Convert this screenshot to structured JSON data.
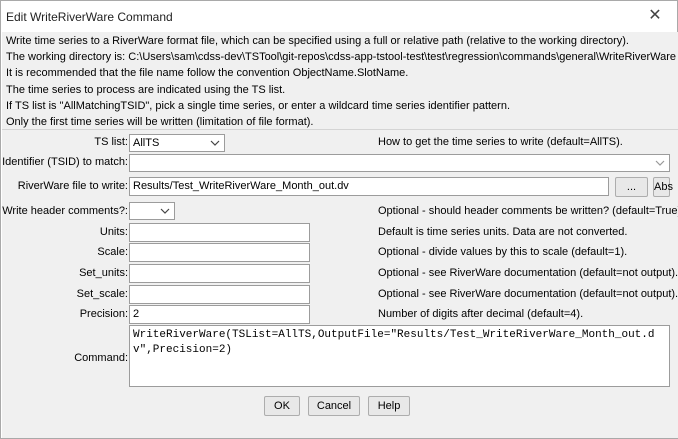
{
  "window": {
    "title": "Edit WriteRiverWare Command",
    "close_glyph": "✕"
  },
  "notes": [
    "Write time series to a RiverWare format file, which can be specified using a full or relative path (relative to the working directory).",
    "The working directory is: C:\\Users\\sam\\cdss-dev\\TSTool\\git-repos\\cdss-app-tstool-test\\test\\regression\\commands\\general\\WriteRiverWare",
    "It is recommended that the file name follow the convention ObjectName.SlotName.",
    "The time series to process are indicated using the TS list.",
    "If TS list is \"AllMatchingTSID\", pick a single time series, or enter a wildcard time series identifier pattern.",
    "Only the first time series will be written (limitation of file format)."
  ],
  "form": {
    "ts_list": {
      "label": "TS list:",
      "value": "AllTS",
      "desc": "How to get the time series to write (default=AllTS)."
    },
    "tsid": {
      "label": "Identifier (TSID) to match:",
      "value": ""
    },
    "output_file": {
      "label": "RiverWare file to write:",
      "value": "Results/Test_WriteRiverWare_Month_out.dv",
      "browse_label": "...",
      "abs_label": "Abs"
    },
    "header": {
      "label": "Write header comments?:",
      "value": "",
      "desc": "Optional - should header comments be written? (default=True)."
    },
    "units": {
      "label": "Units:",
      "value": "",
      "desc": "Default is time series units. Data are not converted."
    },
    "scale": {
      "label": "Scale:",
      "value": "",
      "desc": "Optional - divide values by this to scale (default=1)."
    },
    "set_units": {
      "label": "Set_units:",
      "value": "",
      "desc": "Optional - see RiverWare documentation (default=not output)."
    },
    "set_scale": {
      "label": "Set_scale:",
      "value": "",
      "desc": "Optional - see RiverWare documentation (default=not output)."
    },
    "precision": {
      "label": "Precision:",
      "value": "2",
      "desc": "Number of digits after decimal (default=4)."
    },
    "command": {
      "label": "Command:",
      "value": "WriteRiverWare(TSList=AllTS,OutputFile=\"Results/Test_WriteRiverWare_Month_out.dv\",Precision=2)"
    }
  },
  "buttons": {
    "ok": "OK",
    "cancel": "Cancel",
    "help": "Help"
  }
}
